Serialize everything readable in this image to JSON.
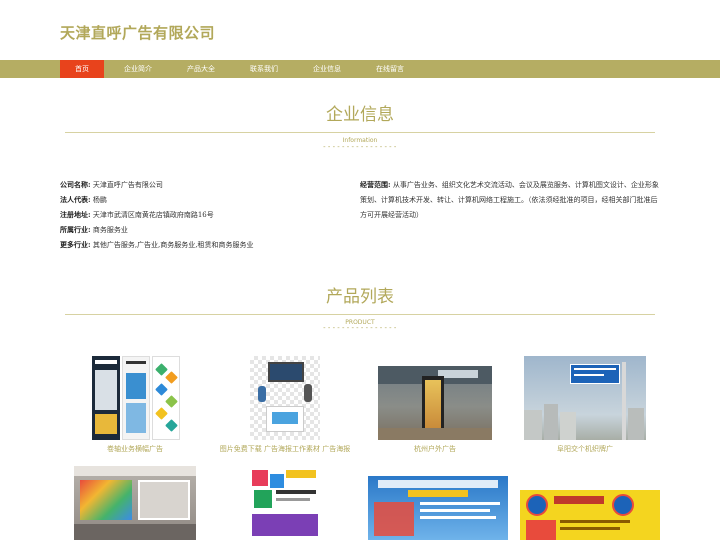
{
  "site": {
    "title": "天津直呼广告有限公司"
  },
  "nav": {
    "items": [
      {
        "label": "首页",
        "active": true
      },
      {
        "label": "企业简介"
      },
      {
        "label": "产品大全"
      },
      {
        "label": "联系我们"
      },
      {
        "label": "企业信息"
      },
      {
        "label": "在线留言"
      }
    ]
  },
  "company_section": {
    "title": "企业信息",
    "subtitle": "Information",
    "dashes": "----------------",
    "fields": [
      {
        "label": "公司名称:",
        "value": "天津直呼广告有限公司"
      },
      {
        "label": "法人代表:",
        "value": "杨鹏"
      },
      {
        "label": "注册地址:",
        "value": "天津市武清区南黄花店镇政府南路16号"
      },
      {
        "label": "所属行业:",
        "value": "商务服务业"
      },
      {
        "label": "更多行业:",
        "value": "其他广告服务,广告业,商务服务业,租赁和商务服务业"
      }
    ],
    "scope": {
      "label": "经营范围:",
      "value": "从事广告业务、组织文化艺术交流活动、会议及展览服务、计算机图文设计、企业形象策划、计算机技术开发、转让、计算机网络工程施工。（依法须经批准的项目，经相关部门批准后方可开展经营活动）"
    }
  },
  "product_section": {
    "title": "产品列表",
    "subtitle": "PRODUCT",
    "dashes": "----------------",
    "items": [
      {
        "caption": "卷轴业务横幅广告"
      },
      {
        "caption": "图片免费下载 广告海报工作素材 广告海报"
      },
      {
        "caption": "杭州户外广告"
      },
      {
        "caption": "阜阳交个机织牌广"
      },
      {
        "caption": ""
      },
      {
        "caption": ""
      },
      {
        "caption": ""
      },
      {
        "caption": ""
      }
    ]
  }
}
